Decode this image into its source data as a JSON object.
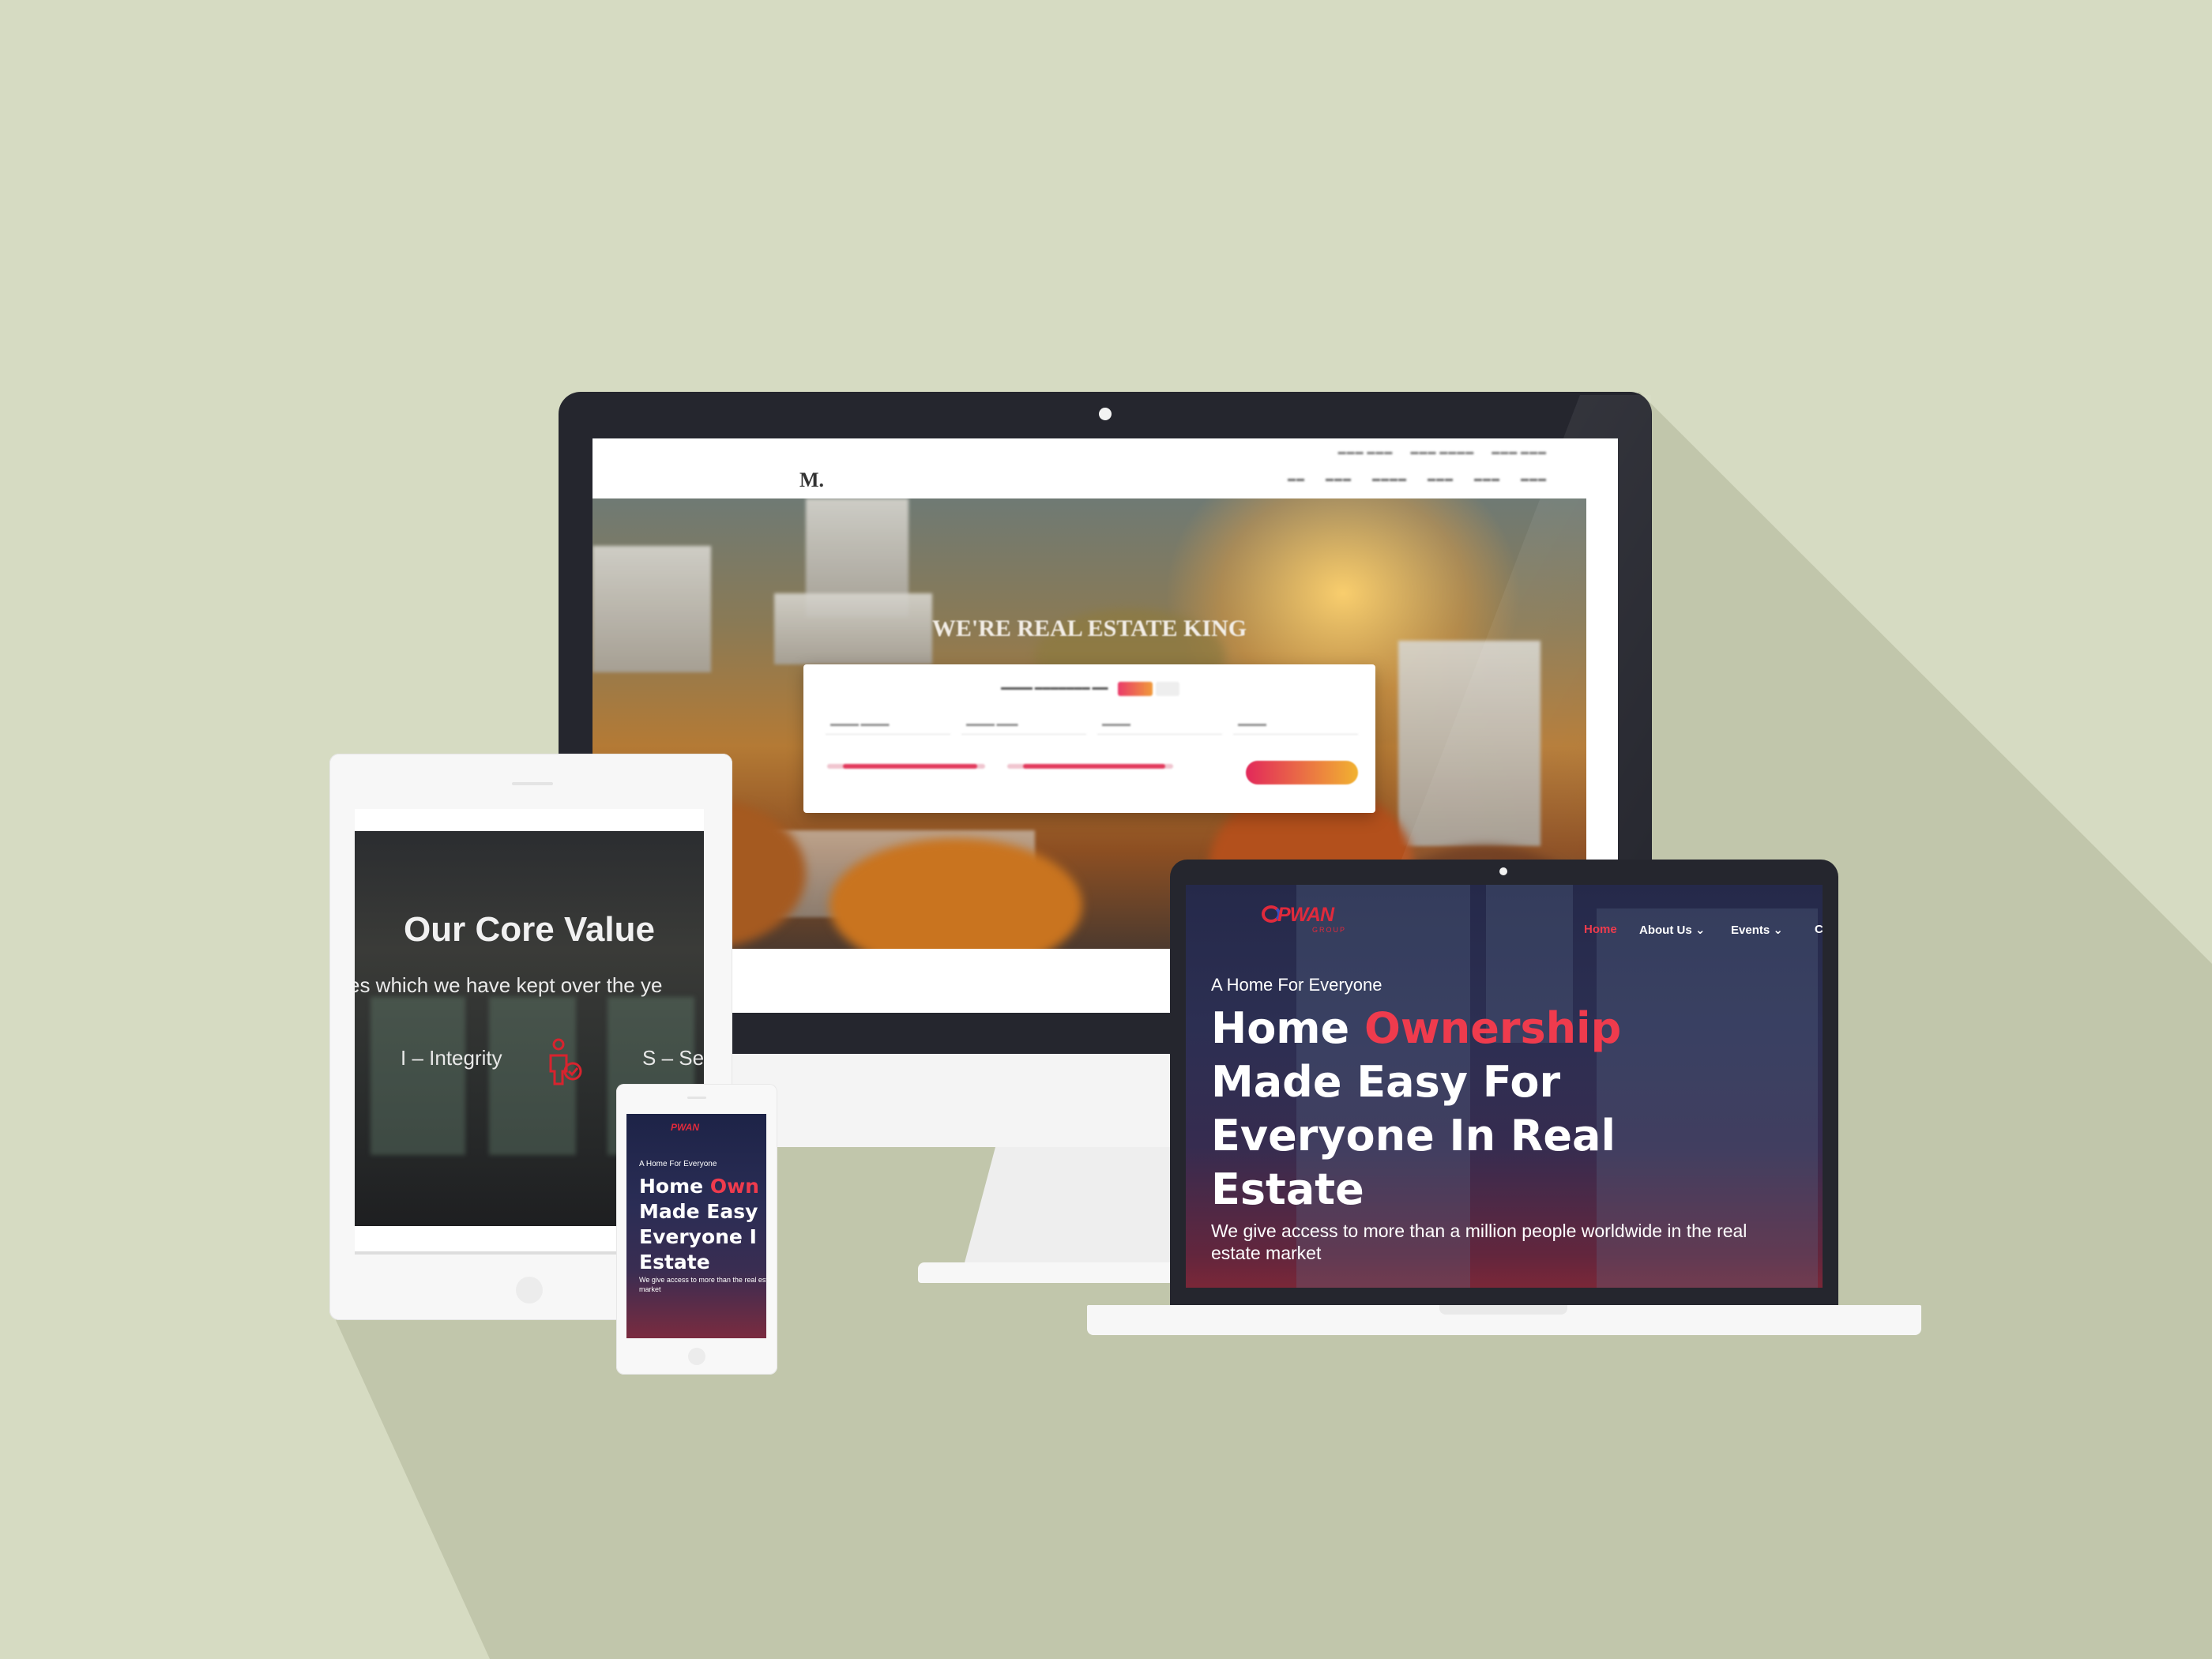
{
  "colors": {
    "background": "#d6dbc2",
    "shadow": "#c1c6ab",
    "device_frame": "#25262e",
    "accent_red": "#ef3b4d"
  },
  "imac_site": {
    "logo": "M.",
    "hero_title": "WE'RE REAL ESTATE KING"
  },
  "tablet_site": {
    "title": "Our Core Value",
    "subtitle": "es which we have kept over the ye",
    "value_1": "I – Integrity",
    "value_2": "S – Se"
  },
  "phone_site": {
    "logo": "PWAN",
    "tagline": "A Home For Everyone",
    "headline_line1_a": "Home ",
    "headline_line1_b": "Own",
    "headline_line2": "Made Easy",
    "headline_line3": "Everyone I",
    "headline_line4": "Estate",
    "description": "We give access to more than the real estate market"
  },
  "laptop_site": {
    "logo": "PWAN",
    "logo_sub": "GROUP",
    "nav": {
      "home": "Home",
      "about": "About Us ⌄",
      "events": "Events ⌄",
      "more": "C"
    },
    "tagline": "A Home For Everyone",
    "headline_line1_a": "Home ",
    "headline_line1_b": "Ownership",
    "headline_line2": "Made Easy For",
    "headline_line3": "Everyone In Real",
    "headline_line4": "Estate",
    "description": "We give access to more than a million people worldwide in the real estate market"
  }
}
